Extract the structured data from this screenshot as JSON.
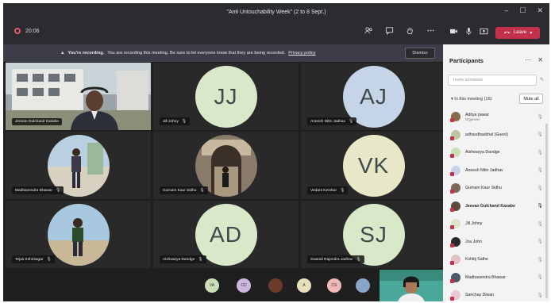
{
  "window": {
    "title": "\"Anti Untouchability Week\" (2 to 8 Sept.)",
    "controls": [
      "–",
      "☐",
      "✕"
    ]
  },
  "toolbar": {
    "elapsed": "20:06",
    "icons": [
      "people-icon",
      "chat-icon",
      "raise-hand-icon",
      "more-icon"
    ],
    "camera_icon": "video-icon",
    "mic_icon": "mic-icon",
    "share_icon": "share-icon",
    "leave_label": "Leave"
  },
  "banner": {
    "strong": "You're recording.",
    "text": "You are recording this meeting. Be sure to let everyone know that they are being recorded.",
    "link": "Privacy policy",
    "dismiss": "Dismiss"
  },
  "tiles": [
    {
      "name": "Jeevan Gulchand Kasabe",
      "type": "photo",
      "mic": ""
    },
    {
      "name": "Jill Johny",
      "type": "initials",
      "initials": "JJ",
      "mic": "🎙"
    },
    {
      "name": "Aneesh Nitin Jadhav",
      "type": "initials",
      "initials": "AJ",
      "mic": "🎙"
    },
    {
      "name": "Madhavendra Bhawar",
      "type": "photo",
      "mic": "🎙"
    },
    {
      "name": "Gurnam Kaur Sidhu",
      "type": "photo",
      "mic": "🎙"
    },
    {
      "name": "Vedant Kerekar",
      "type": "initials",
      "initials": "VK",
      "mic": "🎙"
    },
    {
      "name": "Tejas Kshirsagar",
      "type": "photo",
      "mic": "🎙"
    },
    {
      "name": "Aishwarya Dandge",
      "type": "initials",
      "initials": "AD",
      "mic": "🎙"
    },
    {
      "name": "Swarali Rajendra Jadhav",
      "type": "initials",
      "initials": "SJ",
      "mic": "🎙"
    }
  ],
  "bottom_avatars": [
    {
      "label": "VA",
      "color": "#c9dfb8"
    },
    {
      "label": "CD",
      "color": "#cdb8e0"
    },
    {
      "label": "",
      "color": "#6a3b2a"
    },
    {
      "label": "A",
      "color": "#e8e0b8"
    },
    {
      "label": "CS",
      "color": "#f0b8b8"
    },
    {
      "label": "",
      "color": "#8aa4c8"
    }
  ],
  "participants": {
    "title": "Participants",
    "invite_placeholder": "Invite someone",
    "in_meeting_label": "In this meeting (16)",
    "mute_all": "Mute all",
    "list": [
      {
        "name": "Aditya pawar",
        "sub": "Organizer",
        "color": "#8d6b4a",
        "bold": false,
        "mic_on": false
      },
      {
        "name": "adhavdhavbhal (Guest)",
        "sub": "",
        "color": "#b8c9a0",
        "bold": false,
        "mic_on": false
      },
      {
        "name": "Aishwarya Dandge",
        "sub": "",
        "color": "#c9dfb8",
        "bold": false,
        "mic_on": false
      },
      {
        "name": "Aneesh Nitin Jadhav",
        "sub": "",
        "color": "#c6d4e8",
        "bold": false,
        "mic_on": false
      },
      {
        "name": "Gurnam Kaur Sidhu",
        "sub": "",
        "color": "#7a6a5a",
        "bold": false,
        "mic_on": false
      },
      {
        "name": "Jeevan Gulchand Kasabe",
        "sub": "",
        "color": "#5a4a3a",
        "bold": true,
        "mic_on": true
      },
      {
        "name": "Jill Johny",
        "sub": "",
        "color": "#d8e8c8",
        "bold": false,
        "mic_on": false
      },
      {
        "name": "Jou John",
        "sub": "",
        "color": "#2a2a2a",
        "bold": false,
        "mic_on": false
      },
      {
        "name": "Kshitij Sathe",
        "sub": "",
        "color": "#e0c0c0",
        "bold": false,
        "mic_on": false
      },
      {
        "name": "Madhavendra Bhawar",
        "sub": "",
        "color": "#4a5a6a",
        "bold": false,
        "mic_on": false
      },
      {
        "name": "Sanchay Diwan",
        "sub": "",
        "color": "#e8c8d8",
        "bold": false,
        "mic_on": false
      }
    ]
  },
  "colors": {
    "chrome": "#2b2b30",
    "stage": "#1f1f1f",
    "avatar_bg": "#d8e8c8",
    "leave": "#c4314b"
  }
}
